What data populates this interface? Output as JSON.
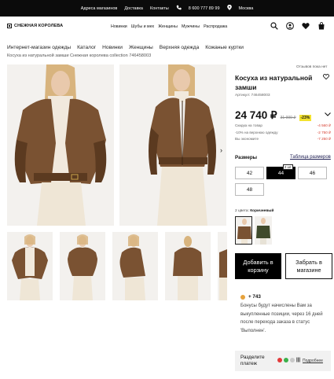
{
  "topbar": {
    "links": [
      "Адреса магазинов",
      "Доставка",
      "Контакты"
    ],
    "phone": "8 600 777 89 99",
    "city": "Москва"
  },
  "header": {
    "logo_text": "СНЕЖНАЯ КОРОЛЕВА",
    "nav": [
      "Новинки",
      "Шубы и мех",
      "Женщины",
      "Мужчины",
      "Распродажа"
    ],
    "icons": [
      "search-icon",
      "account-icon",
      "heart-icon",
      "cart-icon"
    ]
  },
  "subnav": [
    "Интернет-магазин одежды",
    "Каталог",
    "Новинки",
    "Женщины",
    "Верхняя одежда",
    "Кожаные куртки"
  ],
  "breadcrumb": "Косуха из натуральной замши Снежная королева collection 746458003",
  "product": {
    "reviews_link": "Отзывов пока нет",
    "title": "Косуха из натуральной замши",
    "article": "Артикул: 746458003",
    "price": "24 740 ₽",
    "old_price": "31 990 ₽",
    "discount": "-23%",
    "discount_lines": [
      {
        "label": "Скидка на товар",
        "value": "-4 560 ₽"
      },
      {
        "label": "-10% на верхнюю одежду",
        "value": "-2 750 ₽"
      },
      {
        "label": "Вы экономите",
        "value": "-7 250 ₽"
      }
    ],
    "sizes_label": "Размеры",
    "size_table_link": "Таблица размеров",
    "sizes": [
      "42",
      "44",
      "46",
      "48"
    ],
    "size_tag": "2 шт.",
    "colors_count": "2 цвета:",
    "color_name": "Коричневый",
    "add_to_cart": "Добавить в корзину",
    "pick_in_store": "Забрать в магазине",
    "bonus_amount": "+ 743",
    "bonus_text": "Бонусы будут начислены Вам за выкупленные позиции, через 16 дней после перехода заказа в статус 'Выполнен'.",
    "split_label": "Разделите платеж",
    "split_more": "Подробнее"
  },
  "colors": {
    "jacket": "#7a5232",
    "jacket_dark": "#5b3a20",
    "skin": "#e9c9ac",
    "hair": "#d8b47e",
    "sweater": "#f1e9dd",
    "pants": "#efe6d6",
    "photo_bg": "#f3f1ee",
    "accent_yellow": "#f3e22e",
    "discount_red": "#d63a2b"
  }
}
